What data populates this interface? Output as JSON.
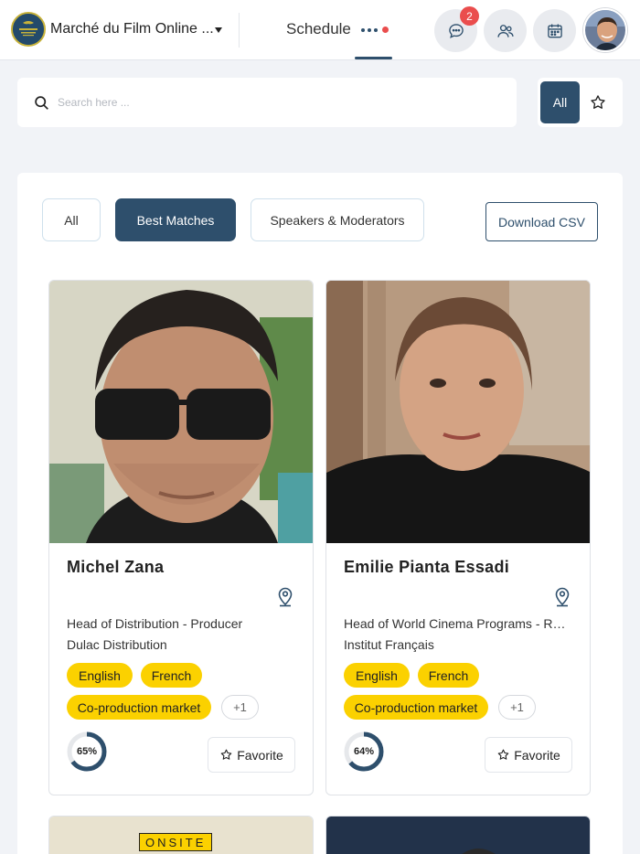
{
  "header": {
    "event_name": "Marché du Film Online ...",
    "schedule_tab": "Schedule",
    "messages_badge": "2",
    "icons": [
      "chat-icon",
      "people-icon",
      "calendar-icon"
    ]
  },
  "search": {
    "placeholder": "Search here ...",
    "value": "",
    "filter_all": "All"
  },
  "filters": {
    "tabs": [
      {
        "label": "All",
        "active": false
      },
      {
        "label": "Best Matches",
        "active": true
      },
      {
        "label": "Speakers & Moderators",
        "active": false
      }
    ],
    "download_csv": "Download CSV"
  },
  "people": [
    {
      "name": "Michel Zana",
      "title": "Head of Distribution - Producer",
      "company": "Dulac Distribution",
      "tags": [
        "English",
        "French",
        "Co-production market"
      ],
      "more": "+1",
      "match": "65%",
      "match_value": 65,
      "favorite_label": "Favorite"
    },
    {
      "name": "Emilie Pianta Essadi",
      "title": "Head of World Cinema Programs - Responsible for the Cinémas du Monde Pavilion",
      "company": "Institut Français",
      "tags": [
        "English",
        "French",
        "Co-production market"
      ],
      "more": "+1",
      "match": "64%",
      "match_value": 64,
      "favorite_label": "Favorite"
    }
  ],
  "next_row": {
    "onsite_label": "ONSITE"
  },
  "colors": {
    "primary": "#2e4f6c",
    "tag_yellow": "#fbd100",
    "badge_red": "#ea4d4d",
    "background": "#f1f3f7"
  }
}
